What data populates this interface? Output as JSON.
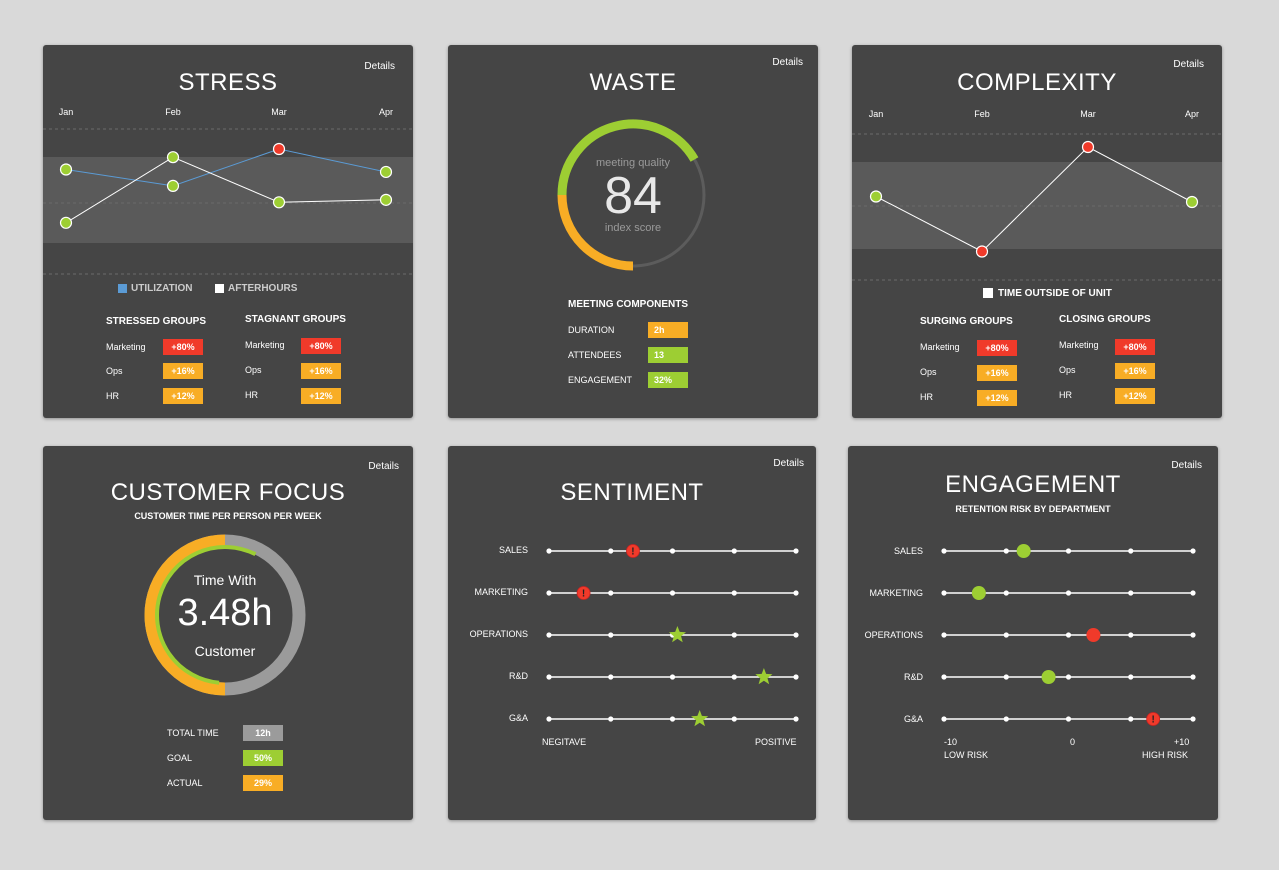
{
  "common": {
    "details_label": "Details"
  },
  "colors": {
    "red": "#f03a2a",
    "orange": "#f8ad25",
    "green": "#9dce33",
    "blue": "#5b9bd5",
    "gray": "#9b9b9b",
    "card": "#454545"
  },
  "stress": {
    "title": "STRESS",
    "months": [
      "Jan",
      "Feb",
      "Mar",
      "Apr"
    ],
    "legend": {
      "utilization": "UTILIZATION",
      "afterhours": "AFTERHOURS"
    },
    "chart_data": {
      "type": "line",
      "categories": [
        "Jan",
        "Feb",
        "Mar",
        "Apr"
      ],
      "series": [
        {
          "name": "UTILIZATION",
          "color": "#5b9bd5",
          "point_colors": [
            "green",
            "green",
            "red",
            "green"
          ],
          "values": [
            0.75,
            0.55,
            1.0,
            0.72
          ]
        },
        {
          "name": "AFTERHOURS",
          "color": "#ffffff",
          "point_colors": [
            "green",
            "green",
            "green",
            "green"
          ],
          "values": [
            0.1,
            0.9,
            0.35,
            0.38
          ]
        }
      ]
    },
    "groups": [
      {
        "header": "STRESSED GROUPS",
        "rows": [
          {
            "name": "Marketing",
            "value": "+80%",
            "color": "red"
          },
          {
            "name": "Ops",
            "value": "+16%",
            "color": "orange"
          },
          {
            "name": "HR",
            "value": "+12%",
            "color": "orange"
          }
        ]
      },
      {
        "header": "STAGNANT GROUPS",
        "rows": [
          {
            "name": "Marketing",
            "value": "+80%",
            "color": "red"
          },
          {
            "name": "Ops",
            "value": "+16%",
            "color": "orange"
          },
          {
            "name": "HR",
            "value": "+12%",
            "color": "orange"
          }
        ]
      }
    ]
  },
  "waste": {
    "title": "WASTE",
    "gauge": {
      "top_label": "meeting quality",
      "value": "84",
      "bottom_label": "index score",
      "score": 84
    },
    "components_header": "MEETING COMPONENTS",
    "components": [
      {
        "name": "DURATION",
        "value": "2h",
        "color": "orange"
      },
      {
        "name": "ATTENDEES",
        "value": "13",
        "color": "green"
      },
      {
        "name": "ENGAGEMENT",
        "value": "32%",
        "color": "green"
      }
    ]
  },
  "complexity": {
    "title": "COMPLEXITY",
    "months": [
      "Jan",
      "Feb",
      "Mar",
      "Apr"
    ],
    "legend": "TIME OUTSIDE OF UNIT",
    "chart_data": {
      "type": "line",
      "categories": [
        "Jan",
        "Feb",
        "Mar",
        "Apr"
      ],
      "series": [
        {
          "name": "TIME OUTSIDE OF UNIT",
          "color": "#ffffff",
          "point_colors": [
            "green",
            "red",
            "red",
            "green"
          ],
          "values": [
            0.55,
            0.05,
            1.0,
            0.5
          ]
        }
      ]
    },
    "groups": [
      {
        "header": "SURGING GROUPS",
        "rows": [
          {
            "name": "Marketing",
            "value": "+80%",
            "color": "red"
          },
          {
            "name": "Ops",
            "value": "+16%",
            "color": "orange"
          },
          {
            "name": "HR",
            "value": "+12%",
            "color": "orange"
          }
        ]
      },
      {
        "header": "CLOSING GROUPS",
        "rows": [
          {
            "name": "Marketing",
            "value": "+80%",
            "color": "red"
          },
          {
            "name": "Ops",
            "value": "+16%",
            "color": "orange"
          },
          {
            "name": "HR",
            "value": "+12%",
            "color": "orange"
          }
        ]
      }
    ]
  },
  "customer": {
    "title": "CUSTOMER FOCUS",
    "subtitle": "CUSTOMER TIME PER PERSON PER WEEK",
    "ring": {
      "line1": "Time With",
      "value": "3.48h",
      "line2": "Customer",
      "goal_fraction": 0.5,
      "actual_fraction": 0.29
    },
    "stats": [
      {
        "name": "TOTAL TIME",
        "value": "12h",
        "color": "gray"
      },
      {
        "name": "GOAL",
        "value": "50%",
        "color": "green"
      },
      {
        "name": "ACTUAL",
        "value": "29%",
        "color": "orange"
      }
    ]
  },
  "sentiment": {
    "title": "SENTIMENT",
    "rows": [
      {
        "name": "SALES",
        "position": 0.34,
        "marker": "alert"
      },
      {
        "name": "MARKETING",
        "position": 0.14,
        "marker": "alert"
      },
      {
        "name": "OPERATIONS",
        "position": 0.52,
        "marker": "star"
      },
      {
        "name": "R&D",
        "position": 0.87,
        "marker": "star"
      },
      {
        "name": "G&A",
        "position": 0.61,
        "marker": "star"
      }
    ],
    "left_label": "NEGITAVE",
    "right_label": "POSITIVE"
  },
  "engagement": {
    "title": "ENGAGEMENT",
    "subtitle": "RETENTION RISK BY DEPARTMENT",
    "rows": [
      {
        "name": "SALES",
        "position": 0.32,
        "marker": "green"
      },
      {
        "name": "MARKETING",
        "position": 0.14,
        "marker": "green"
      },
      {
        "name": "OPERATIONS",
        "position": 0.6,
        "marker": "red"
      },
      {
        "name": "R&D",
        "position": 0.42,
        "marker": "green"
      },
      {
        "name": "G&A",
        "position": 0.84,
        "marker": "alert"
      }
    ],
    "scale": {
      "min": "-10",
      "mid": "0",
      "max": "+10",
      "low_label": "LOW RISK",
      "high_label": "HIGH RISK"
    }
  }
}
